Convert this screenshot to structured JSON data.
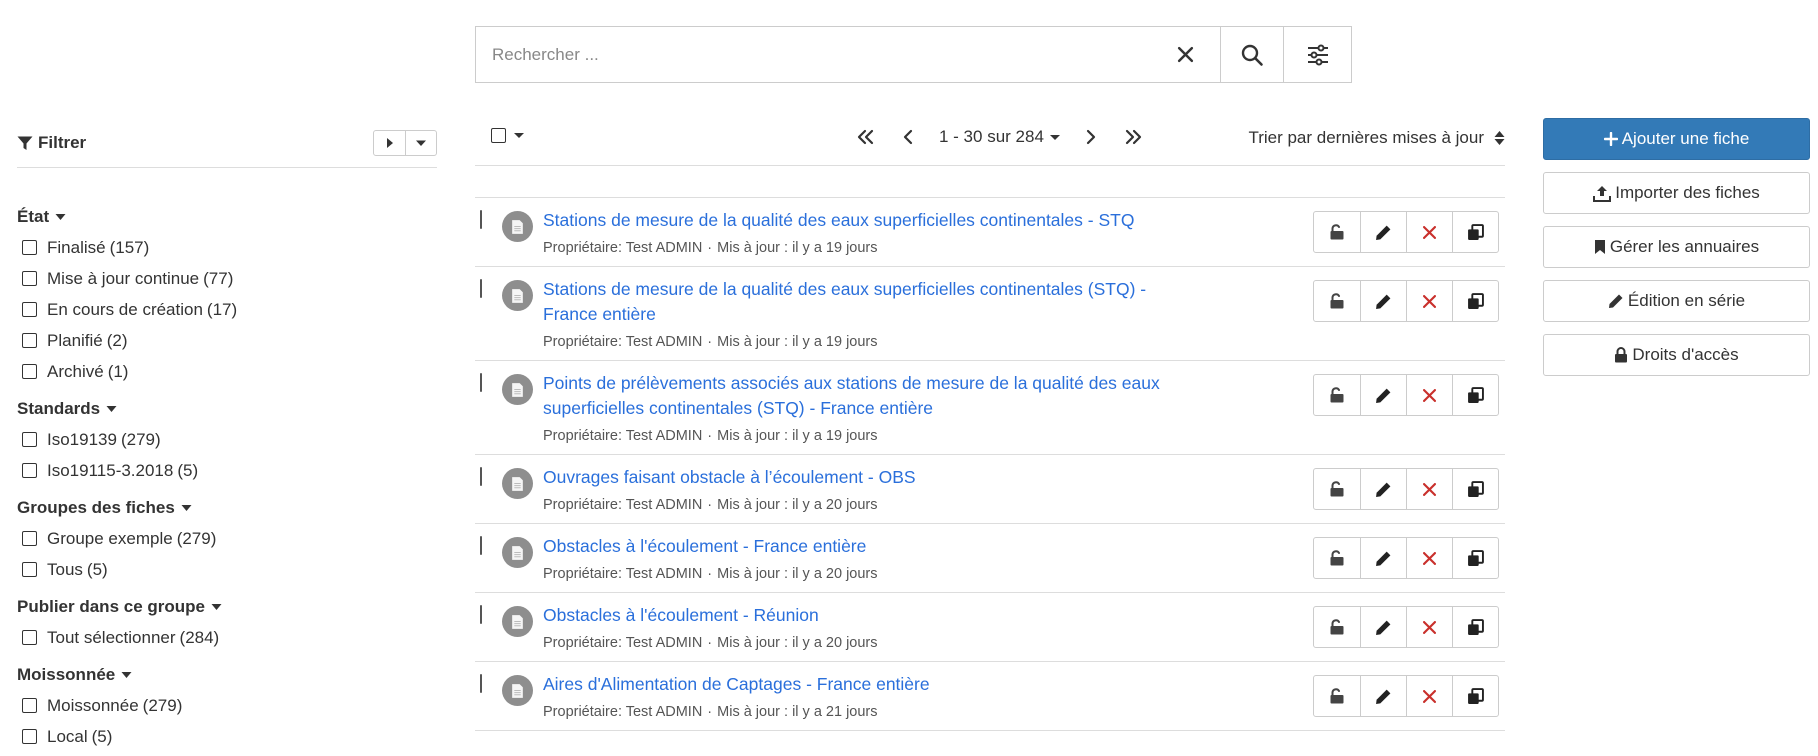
{
  "search": {
    "placeholder": "Rechercher ...",
    "clear_icon": "close-icon",
    "search_icon": "search-icon",
    "advanced_icon": "sliders-icon"
  },
  "sidebar": {
    "filter_label": "Filtrer",
    "facets": [
      {
        "title": "État",
        "items": [
          {
            "label": "Finalisé",
            "count": "(157)"
          },
          {
            "label": "Mise à jour continue",
            "count": "(77)"
          },
          {
            "label": "En cours de création",
            "count": "(17)"
          },
          {
            "label": "Planifié",
            "count": "(2)"
          },
          {
            "label": "Archivé",
            "count": "(1)"
          }
        ]
      },
      {
        "title": "Standards",
        "items": [
          {
            "label": "Iso19139",
            "count": "(279)"
          },
          {
            "label": "Iso19115-3.2018",
            "count": "(5)"
          }
        ]
      },
      {
        "title": "Groupes des fiches",
        "items": [
          {
            "label": "Groupe exemple",
            "count": "(279)"
          },
          {
            "label": "Tous",
            "count": "(5)"
          }
        ]
      },
      {
        "title": "Publier dans ce groupe",
        "items": [
          {
            "label": "Tout sélectionner",
            "count": "(284)"
          }
        ]
      },
      {
        "title": "Moissonnée",
        "items": [
          {
            "label": "Moissonnée",
            "count": "(279)"
          },
          {
            "label": "Local",
            "count": "(5)"
          }
        ]
      }
    ]
  },
  "toolbar": {
    "range": "1 - 30 sur 284",
    "sort": "Trier par dernières mises à jour"
  },
  "results": [
    {
      "title": "Stations de mesure de la qualité des eaux superficielles continentales - STQ",
      "owner": "Propriétaire: Test ADMIN",
      "updated": "Mis à jour : il y a 19 jours"
    },
    {
      "title": "Stations de mesure de la qualité des eaux superficielles continentales (STQ) - France entière",
      "owner": "Propriétaire: Test ADMIN",
      "updated": "Mis à jour : il y a 19 jours"
    },
    {
      "title": "Points de prélèvements associés aux stations de mesure de la qualité des eaux superficielles continentales (STQ) - France entière",
      "owner": "Propriétaire: Test ADMIN",
      "updated": "Mis à jour : il y a 19 jours"
    },
    {
      "title": "Ouvrages faisant obstacle à l’écoulement - OBS",
      "owner": "Propriétaire: Test ADMIN",
      "updated": "Mis à jour : il y a 20 jours"
    },
    {
      "title": "Obstacles à l'écoulement - France entière",
      "owner": "Propriétaire: Test ADMIN",
      "updated": "Mis à jour : il y a 20 jours"
    },
    {
      "title": "Obstacles à l'écoulement - Réunion",
      "owner": "Propriétaire: Test ADMIN",
      "updated": "Mis à jour : il y a 20 jours"
    },
    {
      "title": "Aires d'Alimentation de Captages - France entière",
      "owner": "Propriétaire: Test ADMIN",
      "updated": "Mis à jour : il y a 21 jours"
    }
  ],
  "actions": {
    "add": "Ajouter une fiche",
    "import": "Importer des fiches",
    "directories": "Gérer les annuaires",
    "batch_edit": "Édition en série",
    "access": "Droits d'accès"
  },
  "colors": {
    "primary": "#337ab7",
    "link": "#2a6fdb",
    "delete": "#c9302c"
  }
}
